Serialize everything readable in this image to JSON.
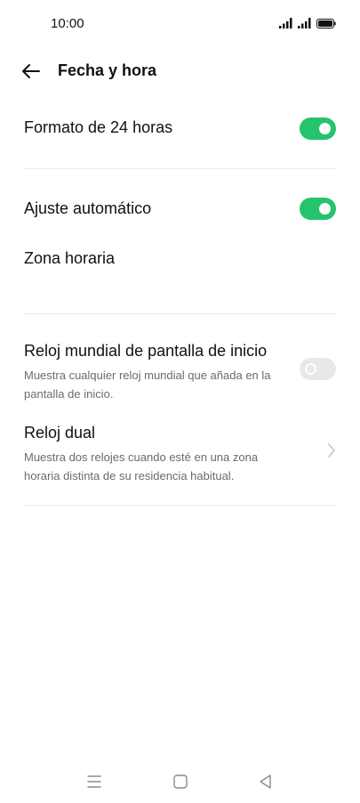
{
  "status_bar": {
    "time": "10:00"
  },
  "header": {
    "title": "Fecha y hora"
  },
  "settings": {
    "format_24h": {
      "label": "Formato de 24 horas",
      "enabled": true
    },
    "auto_adjust": {
      "label": "Ajuste automático",
      "enabled": true
    },
    "time_zone": {
      "label": "Zona horaria"
    },
    "world_clock": {
      "label": "Reloj mundial de pantalla de inicio",
      "description": "Muestra cualquier reloj mundial que añada en la pantalla de inicio.",
      "enabled": false
    },
    "dual_clock": {
      "label": "Reloj dual",
      "description": "Muestra dos relojes cuando esté en una zona horaria distinta de su residencia habitual."
    }
  },
  "colors": {
    "toggle_on": "#25c36c",
    "toggle_off": "#e8e8e8"
  },
  "icons": [
    "back-arrow-icon",
    "signal-icon",
    "battery-icon",
    "chevron-right-icon",
    "menu-icon",
    "home-icon",
    "back-icon"
  ]
}
